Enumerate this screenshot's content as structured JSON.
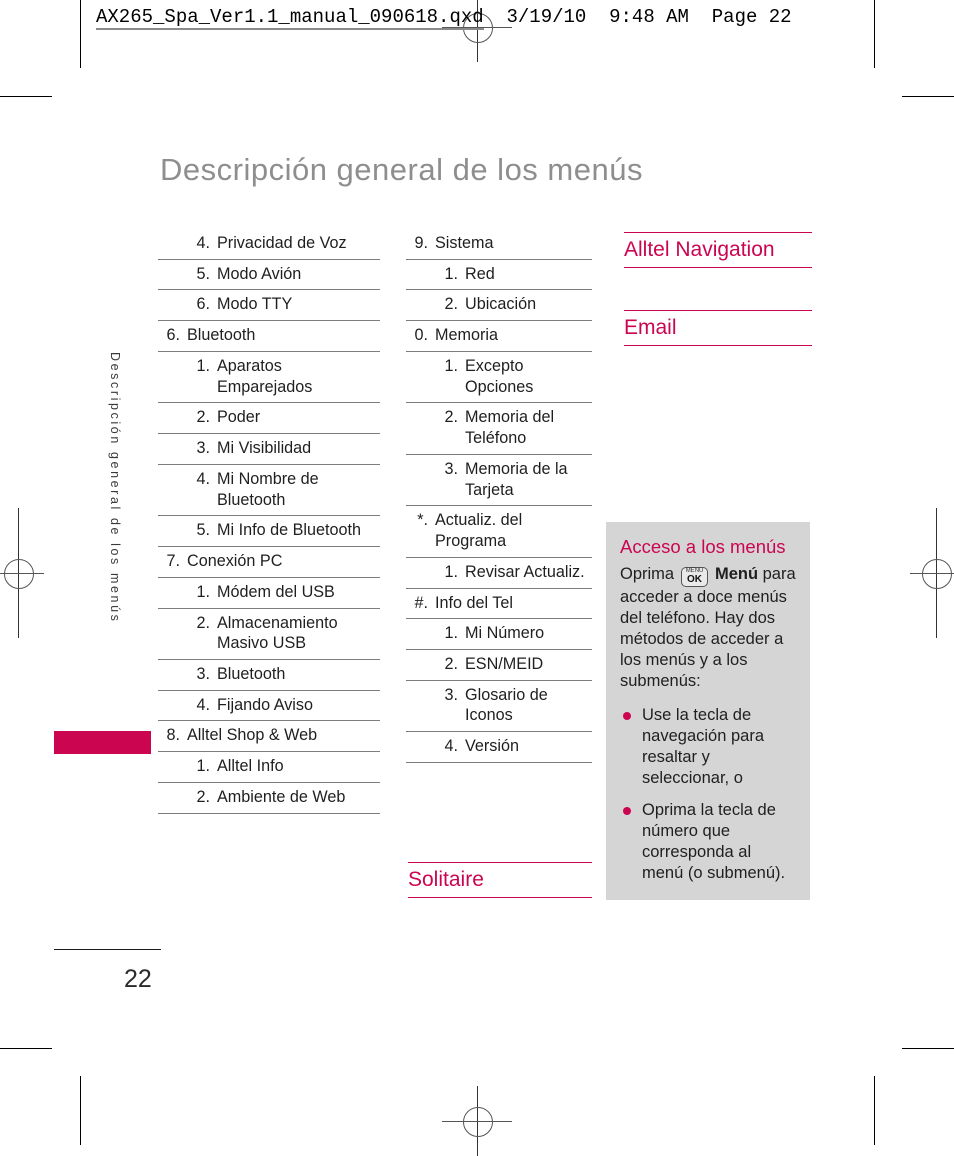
{
  "file_header": {
    "filename": "AX265_Spa_Ver1.1_manual_090618.qxd",
    "date": "3/19/10",
    "time": "9:48 AM",
    "page_label": "Page",
    "page_value": "22"
  },
  "page": {
    "title": "Descripción general de los menús",
    "side_tab_text": "Descripción general de los menús",
    "number": "22"
  },
  "colors": {
    "accent": "#cc0550",
    "title_gray": "#8e8e8e",
    "infobox_bg": "#d5d5d5",
    "rule_gray": "#7d7d7d"
  },
  "column1": {
    "rows": [
      {
        "num": "4.",
        "text": "Privacidad de Voz",
        "level": 2,
        "first": true
      },
      {
        "num": "5.",
        "text": "Modo Avión",
        "level": 2
      },
      {
        "num": "6.",
        "text": "Modo TTY",
        "level": 2
      },
      {
        "num": "6.",
        "text": "Bluetooth",
        "level": 1
      },
      {
        "num": "1.",
        "text": "Aparatos Emparejados",
        "level": 2
      },
      {
        "num": "2.",
        "text": "Poder",
        "level": 2
      },
      {
        "num": "3.",
        "text": "Mi Visibilidad",
        "level": 2
      },
      {
        "num": "4.",
        "text": "Mi Nombre de Bluetooth",
        "level": 2
      },
      {
        "num": "5.",
        "text": "Mi Info de Bluetooth",
        "level": 2
      },
      {
        "num": "7.",
        "text": "Conexión PC",
        "level": 1
      },
      {
        "num": "1.",
        "text": "Módem del USB",
        "level": 2
      },
      {
        "num": "2.",
        "text": "Almacenamiento Masivo USB",
        "level": 2
      },
      {
        "num": "3.",
        "text": "Bluetooth",
        "level": 2
      },
      {
        "num": "4.",
        "text": "Fijando Aviso",
        "level": 2
      },
      {
        "num": "8.",
        "text": "Alltel Shop & Web",
        "level": 1
      },
      {
        "num": "1.",
        "text": "Alltel Info",
        "level": 2
      },
      {
        "num": "2.",
        "text": "Ambiente de Web",
        "level": 2
      }
    ]
  },
  "column2": {
    "rows": [
      {
        "num": "9.",
        "text": "Sistema",
        "level": 1,
        "first": true
      },
      {
        "num": "1.",
        "text": "Red",
        "level": 2
      },
      {
        "num": "2.",
        "text": "Ubicación",
        "level": 2
      },
      {
        "num": "0.",
        "text": "Memoria",
        "level": 1
      },
      {
        "num": "1.",
        "text": "Excepto Opciones",
        "level": 2
      },
      {
        "num": "2.",
        "text": "Memoria del Teléfono",
        "level": 2
      },
      {
        "num": "3.",
        "text": "Memoria de la Tarjeta",
        "level": 2
      },
      {
        "num": "*.",
        "text": "Actualiz. del Programa",
        "level": 1
      },
      {
        "num": "1.",
        "text": "Revisar Actualiz.",
        "level": 2
      },
      {
        "num": "#.",
        "text": "Info del Tel",
        "level": 1
      },
      {
        "num": "1.",
        "text": "Mi Número",
        "level": 2
      },
      {
        "num": "2.",
        "text": "ESN/MEID",
        "level": 2
      },
      {
        "num": "3.",
        "text": "Glosario de Iconos",
        "level": 2
      },
      {
        "num": "4.",
        "text": "Versión",
        "level": 2
      }
    ]
  },
  "sections": {
    "alltel_navigation": "Alltel Navigation",
    "email": "Email",
    "solitaire": "Solitaire"
  },
  "infobox": {
    "title": "Acceso a los menús",
    "intro_before_key": "Oprima ",
    "key_line1": "MENU",
    "key_line2": "OK",
    "key_label": "Menú",
    "intro_after_key": " para acceder a doce menús del teléfono. Hay dos métodos de acceder a los menús y a los submenús:",
    "bullets": [
      "Use la tecla de navegación para resaltar y seleccionar, o",
      "Oprima la tecla de número que corresponda al menú (o submenú)."
    ]
  }
}
